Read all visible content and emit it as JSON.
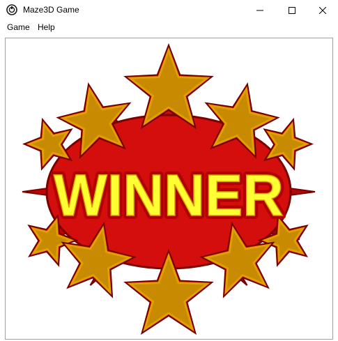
{
  "window": {
    "title": "Maze3D Game",
    "icon": "maze3d-app-icon"
  },
  "menu": {
    "items": [
      {
        "label": "Game"
      },
      {
        "label": "Help"
      }
    ]
  },
  "content": {
    "banner_text": "WINNER",
    "image": "winner-stars-burst",
    "colors": {
      "burst_red": "#d40d0d",
      "burst_dark": "#7a0000",
      "star_gold": "#c88a00",
      "star_border": "#e0a000",
      "text_fill": "#ffff33",
      "text_outline": "#b00000"
    }
  }
}
